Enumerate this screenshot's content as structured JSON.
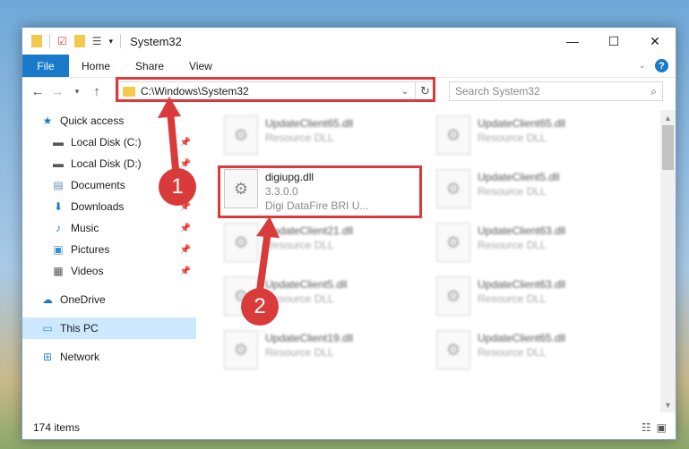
{
  "window": {
    "title": "System32"
  },
  "ribbon": {
    "tabs": [
      "File",
      "Home",
      "Share",
      "View"
    ],
    "help": "?"
  },
  "address": {
    "path": "C:\\Windows\\System32"
  },
  "search": {
    "placeholder": "Search System32"
  },
  "sidebar": {
    "items": [
      {
        "label": "Quick access",
        "icon": "star-icon",
        "pinned": false
      },
      {
        "label": "Local Disk (C:)",
        "icon": "drive-icon",
        "pinned": true
      },
      {
        "label": "Local Disk (D:)",
        "icon": "drive-icon",
        "pinned": true
      },
      {
        "label": "Documents",
        "icon": "documents-icon",
        "pinned": true
      },
      {
        "label": "Downloads",
        "icon": "download-icon",
        "pinned": true
      },
      {
        "label": "Music",
        "icon": "music-icon",
        "pinned": true
      },
      {
        "label": "Pictures",
        "icon": "pictures-icon",
        "pinned": true
      },
      {
        "label": "Videos",
        "icon": "videos-icon",
        "pinned": true
      },
      {
        "label": "OneDrive",
        "icon": "cloud-icon",
        "pinned": false
      },
      {
        "label": "This PC",
        "icon": "computer-icon",
        "pinned": false
      },
      {
        "label": "Network",
        "icon": "network-icon",
        "pinned": false
      }
    ]
  },
  "files": {
    "highlighted": {
      "name": "digiupg.dll",
      "version": "3.3.0.0",
      "description": "Digi DataFire BRI U..."
    },
    "background": [
      {
        "name": "UpdateClient65.dll",
        "type": "Resource DLL"
      },
      {
        "name": "UpdateClient65.dll",
        "type": "Resource DLL"
      },
      {
        "name": "UpdateClient5.dll",
        "type": "Resource DLL"
      },
      {
        "name": "UpdateClient21.dll",
        "type": "Resource DLL"
      },
      {
        "name": "UpdateClient63.dll",
        "type": "Resource DLL"
      },
      {
        "name": "UpdateClient5.dll",
        "type": "Resource DLL"
      },
      {
        "name": "UpdateClient63.dll",
        "type": "Resource DLL"
      },
      {
        "name": "UpdateClient19.dll",
        "type": "Resource DLL"
      },
      {
        "name": "UpdateClient65.dll",
        "type": "Resource DLL"
      }
    ]
  },
  "status": {
    "count": "174 items"
  },
  "annotations": {
    "step1": "1",
    "step2": "2"
  },
  "colors": {
    "accent": "#1979ca",
    "highlight": "#d93b3b"
  }
}
